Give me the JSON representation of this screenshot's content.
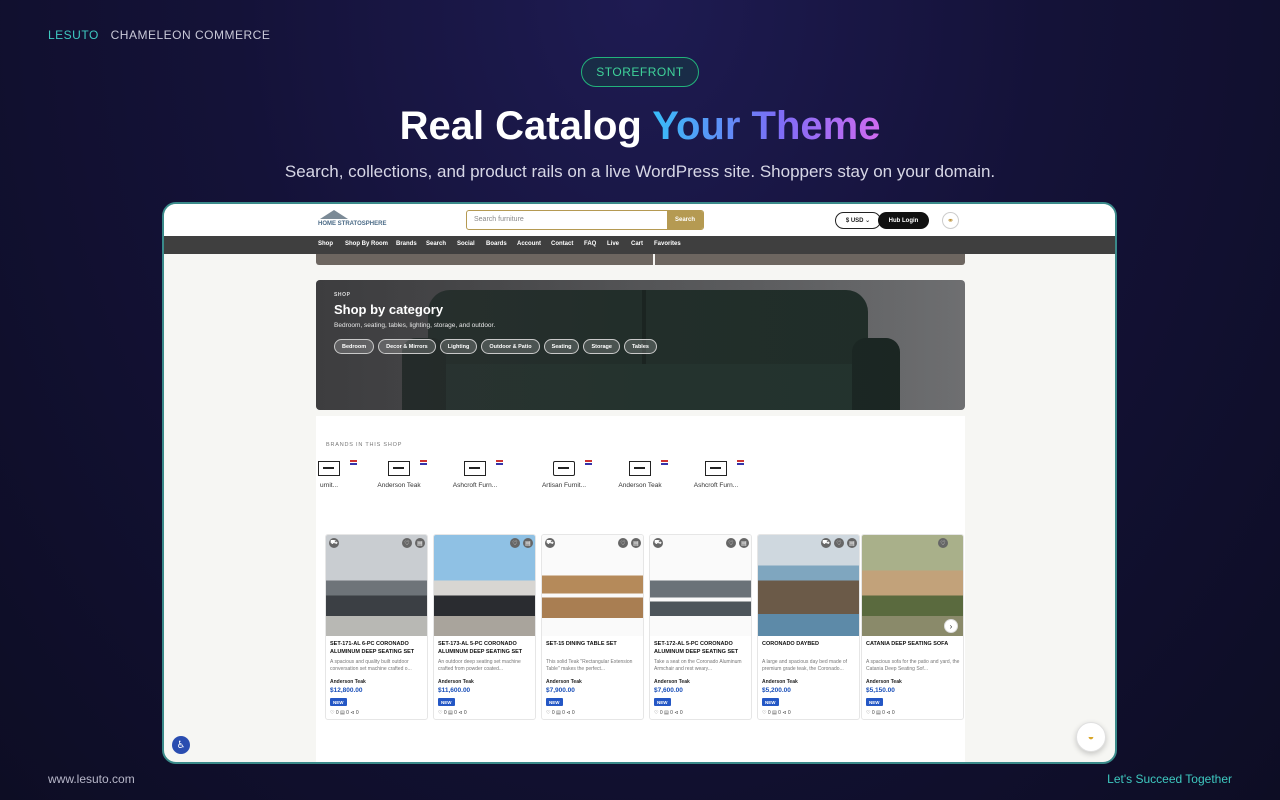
{
  "slide": {
    "brand": "LESUTO",
    "product": "CHAMELEON COMMERCE",
    "pill": "STOREFRONT",
    "headline_plain": "Real Catalog ",
    "headline_accent": "Your Theme",
    "subline": "Search, collections, and product rails on a live WordPress site. Shoppers stay on your domain.",
    "footer_left": "www.lesuto.com",
    "footer_right": "Let's Succeed Together"
  },
  "site": {
    "logo_text": "HOME STRATOSPHERE",
    "search_placeholder": "Search furniture",
    "search_button": "Search",
    "currency": "$ USD ⌄",
    "hub_login": "Hub Login",
    "nav": [
      "Shop",
      "Shop By Room",
      "Brands",
      "Search",
      "Social",
      "Boards",
      "Account",
      "Contact",
      "FAQ",
      "Live",
      "Cart",
      "Favorites"
    ]
  },
  "hero": {
    "kicker": "SHOP",
    "title": "Shop by category",
    "desc": "Bedroom, seating, tables, lighting, storage, and outdoor.",
    "chips": [
      "Bedroom",
      "Decor & Mirrors",
      "Lighting",
      "Outdoor & Patio",
      "Seating",
      "Storage",
      "Tables"
    ]
  },
  "brands": {
    "heading": "BRANDS IN THIS SHOP",
    "items": [
      "urnit...",
      "Anderson Teak",
      "Ashcroft Furn...",
      "Artisan Furnit...",
      "Anderson Teak",
      "Ashcroft Furn..."
    ]
  },
  "products": [
    {
      "name": "SET-171-AL 6-PC CORONADO ALUMINUM DEEP SEATING SET",
      "desc": "A spacious and quality built outdoor conversation set machine crafted o...",
      "brand": "Anderson Teak",
      "price": "$12,800.00",
      "badge": "NEW",
      "stats": "♡ 0  ▤ 0  ⊲ 0"
    },
    {
      "name": "SET-173-AL 5-PC CORONADO ALUMINUM DEEP SEATING SET",
      "desc": "An outdoor deep seating set machine crafted from powder coated...",
      "brand": "Anderson Teak",
      "price": "$11,600.00",
      "badge": "NEW",
      "stats": "♡ 0  ▤ 0  ⊲ 0"
    },
    {
      "name": "SET-15 DINING TABLE SET",
      "desc": "This solid Teak \"Rectangular Extension Table\" makes the perfect...",
      "brand": "Anderson Teak",
      "price": "$7,900.00",
      "badge": "NEW",
      "stats": "♡ 0  ▤ 0  ⊲ 0"
    },
    {
      "name": "SET-172-AL 5-PC CORONADO ALUMINUM DEEP SEATING SET",
      "desc": "Take a seat on the Coronado Aluminum Armchair and rest weary...",
      "brand": "Anderson Teak",
      "price": "$7,600.00",
      "badge": "NEW",
      "stats": "♡ 0  ▤ 0  ⊲ 0"
    },
    {
      "name": "CORONADO DAYBED",
      "desc": "A large and spacious day bed made of premium grade teak, the Coronado...",
      "brand": "Anderson Teak",
      "price": "$5,200.00",
      "badge": "NEW",
      "stats": "♡ 0  ▤ 0  ⊲ 0"
    },
    {
      "name": "CATANIA DEEP SEATING SOFA",
      "desc": "A spacious sofa for the patio and yard, the Catania Deep Seating Sof...",
      "brand": "Anderson Teak",
      "price": "$5,150.00",
      "badge": "NEW",
      "stats": "♡ 0  ▤ 0  ⊲ 0"
    }
  ],
  "colors": {
    "accent_teal": "#3ec9c0",
    "accent_green": "#22b27b",
    "price_blue": "#1a4fb8",
    "gold": "#b59a52"
  }
}
